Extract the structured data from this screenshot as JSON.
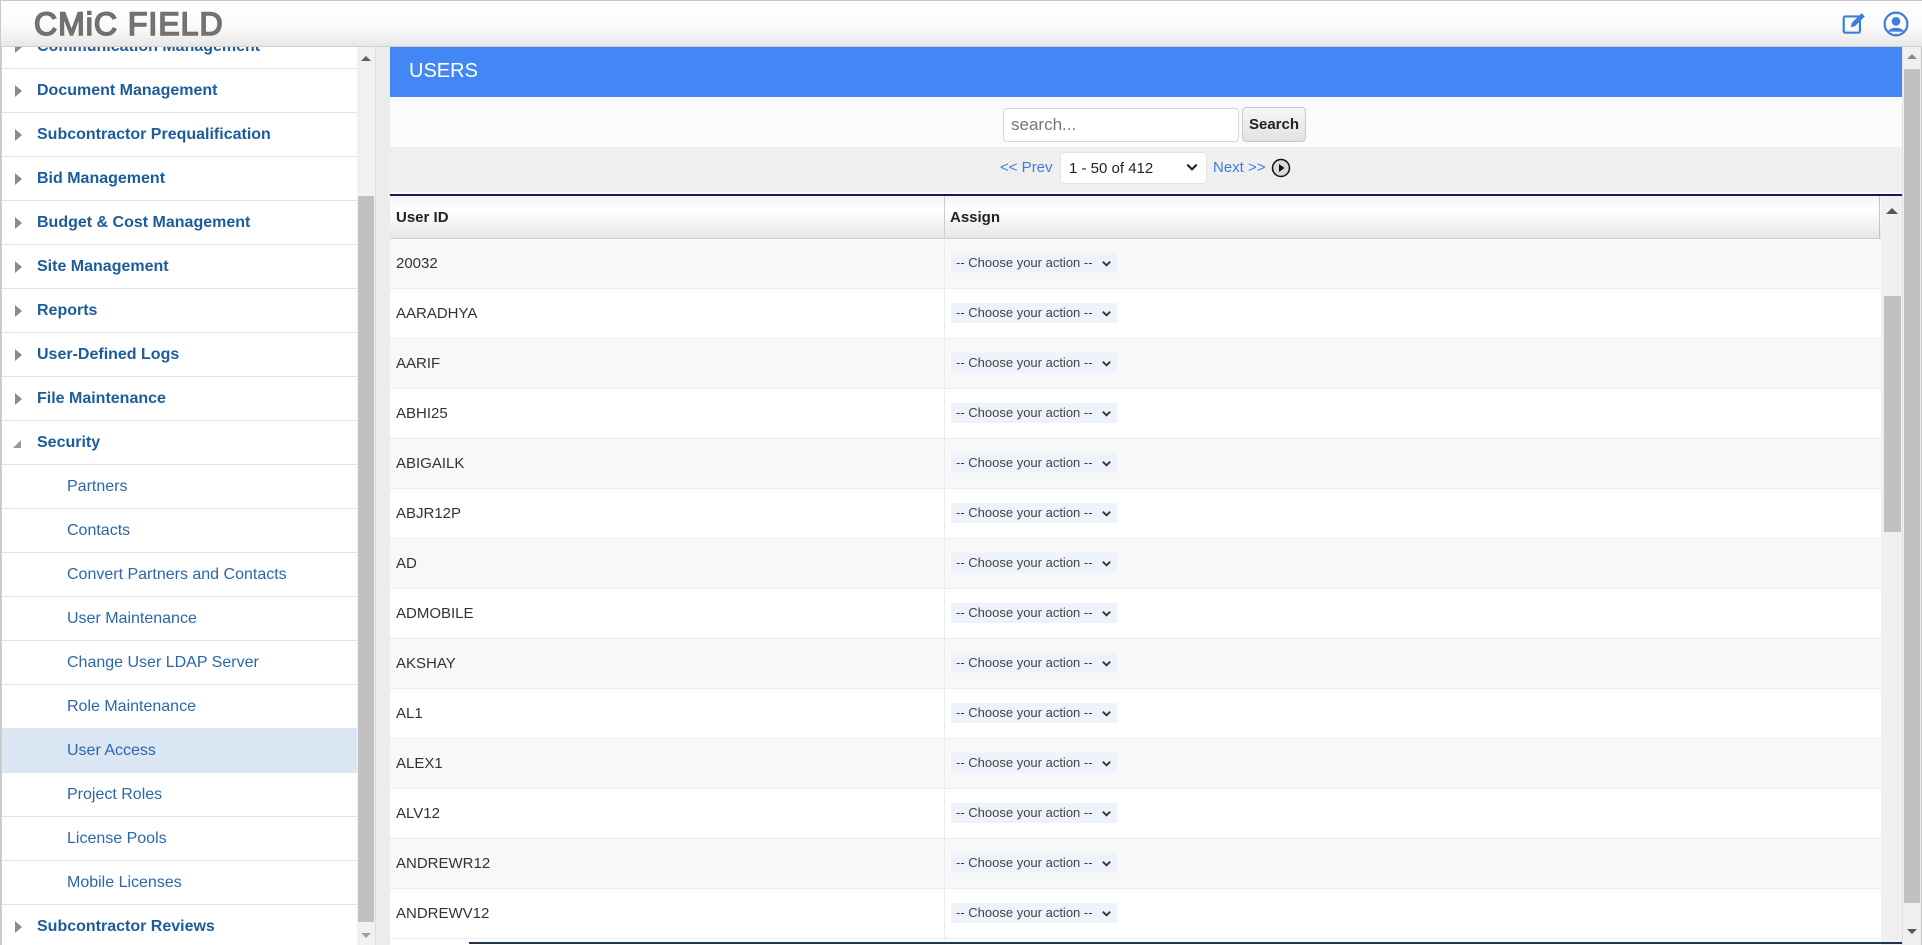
{
  "header": {
    "logo": "CMiC FIELD",
    "icons": [
      "edit-icon",
      "user-profile-icon"
    ]
  },
  "sidebar": {
    "items": [
      {
        "label": "Communication Management",
        "level": "top",
        "state": "collapsed"
      },
      {
        "label": "Document Management",
        "level": "top",
        "state": "collapsed"
      },
      {
        "label": "Subcontractor Prequalification",
        "level": "top",
        "state": "collapsed"
      },
      {
        "label": "Bid Management",
        "level": "top",
        "state": "collapsed"
      },
      {
        "label": "Budget & Cost Management",
        "level": "top",
        "state": "collapsed"
      },
      {
        "label": "Site Management",
        "level": "top",
        "state": "collapsed"
      },
      {
        "label": "Reports",
        "level": "top",
        "state": "collapsed"
      },
      {
        "label": "User-Defined Logs",
        "level": "top",
        "state": "collapsed"
      },
      {
        "label": "File Maintenance",
        "level": "top",
        "state": "collapsed"
      },
      {
        "label": "Security",
        "level": "top",
        "state": "expanded"
      },
      {
        "label": "Partners",
        "level": "sub"
      },
      {
        "label": "Contacts",
        "level": "sub"
      },
      {
        "label": "Convert Partners and Contacts",
        "level": "sub"
      },
      {
        "label": "User Maintenance",
        "level": "sub"
      },
      {
        "label": "Change User LDAP Server",
        "level": "sub"
      },
      {
        "label": "Role Maintenance",
        "level": "sub"
      },
      {
        "label": "User Access",
        "level": "sub",
        "active": true
      },
      {
        "label": "Project Roles",
        "level": "sub"
      },
      {
        "label": "License Pools",
        "level": "sub"
      },
      {
        "label": "Mobile Licenses",
        "level": "sub"
      },
      {
        "label": "Subcontractor Reviews",
        "level": "top",
        "state": "collapsed"
      }
    ]
  },
  "main": {
    "title": "USERS",
    "search": {
      "placeholder": "search...",
      "value": "",
      "button_label": "Search"
    },
    "pager": {
      "prev_label": "<< Prev",
      "selected_range": "1 - 50 of 412",
      "next_label": "Next >>"
    },
    "table": {
      "columns": [
        "User ID",
        "Assign"
      ],
      "action_placeholder": "-- Choose your action --",
      "rows": [
        "20032",
        "AARADHYA",
        "AARIF",
        "ABHI25",
        "ABIGAILK",
        "ABJR12P",
        "AD",
        "ADMOBILE",
        "AKSHAY",
        "AL1",
        "ALEX1",
        "ALV12",
        "ANDREWR12",
        "ANDREWV12"
      ]
    }
  },
  "colors": {
    "accent": "#4287f5",
    "nav_text": "#1c5c9c",
    "active_nav_bg": "#dae6f3",
    "link": "#3b7ddd",
    "header_rule": "#15176b"
  }
}
